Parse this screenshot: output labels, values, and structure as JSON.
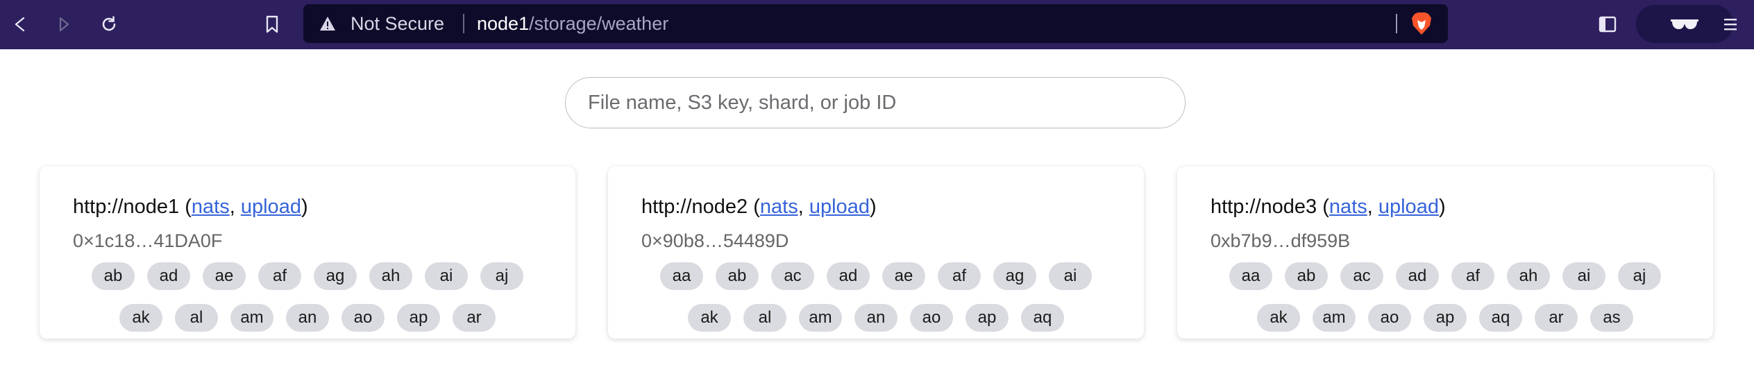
{
  "browser": {
    "security_label": "Not Secure",
    "url_host": "node1",
    "url_path": "/storage/weather",
    "icons": {
      "back": "back-arrow-icon",
      "forward": "forward-arrow-icon",
      "reload": "reload-icon",
      "bookmark": "bookmark-icon",
      "warning": "warning-triangle-icon",
      "brave": "brave-lion-icon",
      "sidebar": "sidebar-toggle-icon",
      "profile": "private-glasses-icon",
      "menu": "hamburger-menu-icon"
    },
    "colors": {
      "toolbar": "#2e1f5e",
      "urlbar": "#0e0b2a",
      "brave": "#fb542b"
    }
  },
  "search": {
    "placeholder": "File name, S3 key, shard, or job ID"
  },
  "nodes": [
    {
      "url": "http://node1",
      "open_paren": " (",
      "link_nats": "nats",
      "comma": ", ",
      "link_upload": "upload",
      "close_paren": ")",
      "key": "0×1c18…41DA0F",
      "shards_row1": [
        "ab",
        "ad",
        "ae",
        "af",
        "ag",
        "ah",
        "ai",
        "aj"
      ],
      "shards_row2": [
        "ak",
        "al",
        "am",
        "an",
        "ao",
        "ap",
        "ar"
      ]
    },
    {
      "url": "http://node2",
      "open_paren": " (",
      "link_nats": "nats",
      "comma": ", ",
      "link_upload": "upload",
      "close_paren": ")",
      "key": "0×90b8…54489D",
      "shards_row1": [
        "aa",
        "ab",
        "ac",
        "ad",
        "ae",
        "af",
        "ag",
        "ai"
      ],
      "shards_row2": [
        "ak",
        "al",
        "am",
        "an",
        "ao",
        "ap",
        "aq"
      ]
    },
    {
      "url": "http://node3",
      "open_paren": " (",
      "link_nats": "nats",
      "comma": ", ",
      "link_upload": "upload",
      "close_paren": ")",
      "key": "0xb7b9…df959B",
      "shards_row1": [
        "aa",
        "ab",
        "ac",
        "ad",
        "af",
        "ah",
        "ai",
        "aj"
      ],
      "shards_row2": [
        "ak",
        "am",
        "ao",
        "ap",
        "aq",
        "ar",
        "as"
      ]
    }
  ],
  "colors": {
    "link": "#3563d9",
    "shard_bg": "#d9dbe0"
  }
}
